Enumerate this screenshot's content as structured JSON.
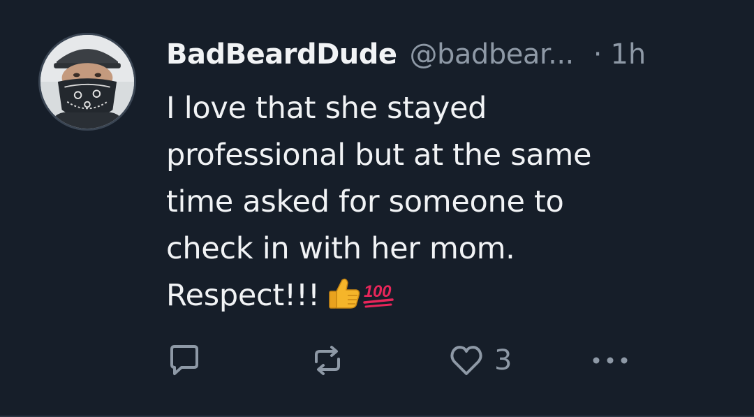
{
  "post": {
    "author_name": "BadBeardDude",
    "author_handle": "@badbear...",
    "separator": "·",
    "timestamp": "1h",
    "text_lines": [
      "I love that she stayed",
      "professional but at the same",
      "time asked for someone to",
      "check in with her mom.",
      "Respect!!!"
    ],
    "emojis": [
      "thumbs-up",
      "hundred-points"
    ]
  },
  "actions": {
    "reply_icon": "speech-bubble-icon",
    "repost_icon": "repost-arrows-icon",
    "like_icon": "heart-icon",
    "like_count": "3",
    "more_icon": "ellipsis-icon"
  },
  "colors": {
    "background": "#161e29",
    "text": "#f1f3f5",
    "muted": "#8e99a6",
    "divider": "#2b3644"
  }
}
